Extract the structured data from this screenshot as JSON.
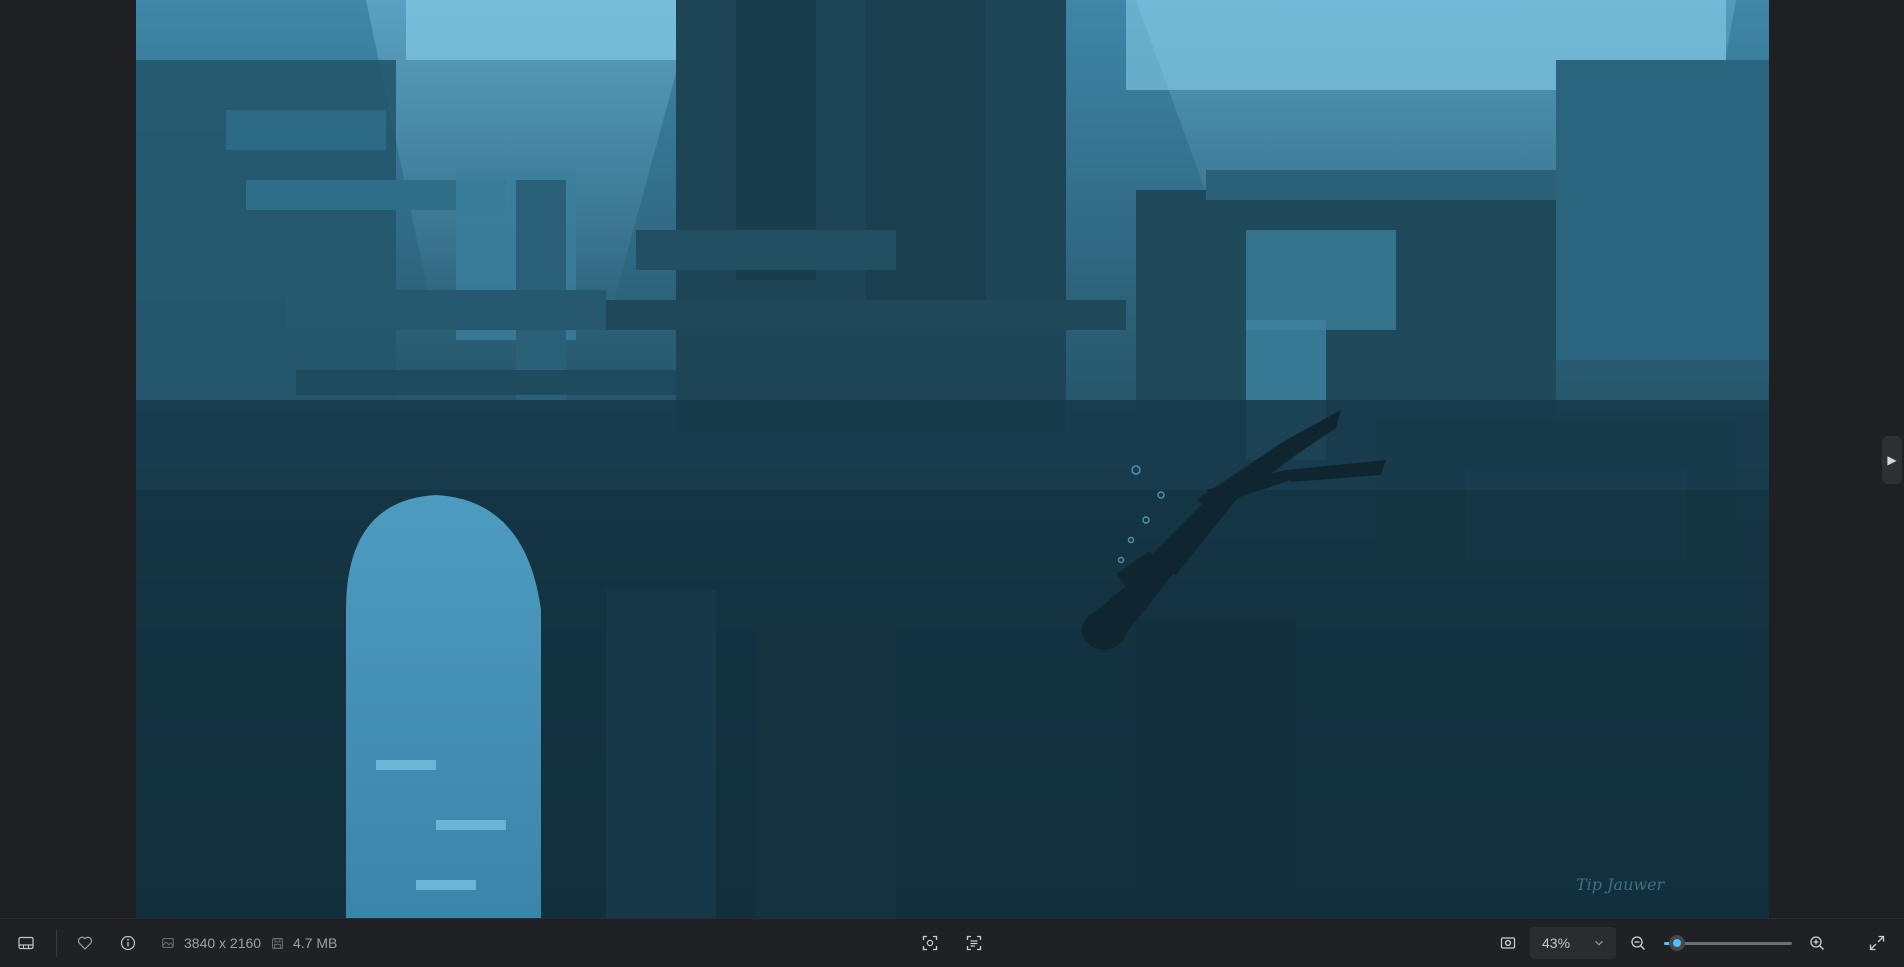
{
  "viewer": {
    "next_arrow_glyph": "▶",
    "image_signature": "Tip Jauwer"
  },
  "toolbar": {
    "filmstrip_icon": "filmstrip-icon",
    "favorite_icon": "heart-icon",
    "info_icon": "info-icon",
    "dimensions": "3840 x 2160",
    "file_size": "4.7 MB",
    "zoom_level": "43%",
    "zoom_fraction": 0.1,
    "colors": {
      "accent": "#4cc2ff",
      "toolbar_bg": "#202124",
      "text": "#9aa0a6"
    }
  }
}
